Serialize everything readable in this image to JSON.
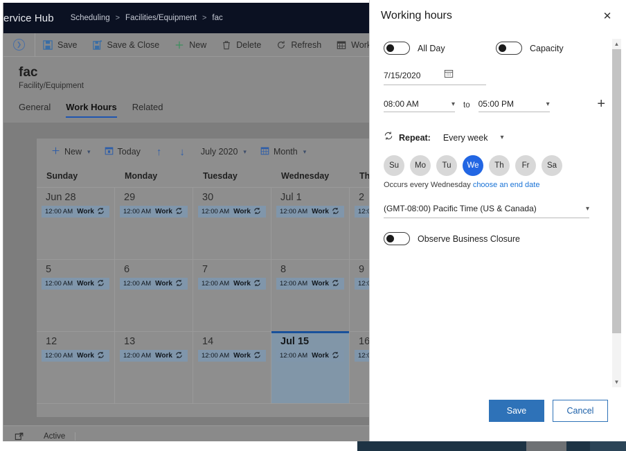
{
  "app": {
    "brand": "ervice Hub",
    "breadcrumb": [
      "Scheduling",
      "Facilities/Equipment",
      "fac"
    ],
    "breadcrumb_separator": ">"
  },
  "commandbar": {
    "expand_icon": "chevron-circle-icon",
    "items": [
      {
        "label": "Save",
        "icon": "save-icon"
      },
      {
        "label": "Save & Close",
        "icon": "save-close-icon"
      },
      {
        "label": "New",
        "icon": "plus-icon"
      },
      {
        "label": "Delete",
        "icon": "trash-icon"
      },
      {
        "label": "Refresh",
        "icon": "refresh-icon"
      },
      {
        "label": "Work H",
        "icon": "calendar-grid-icon"
      }
    ]
  },
  "record": {
    "title": "fac",
    "subtitle": "Facility/Equipment",
    "tabs": [
      {
        "label": "General",
        "active": false
      },
      {
        "label": "Work Hours",
        "active": true
      },
      {
        "label": "Related",
        "active": false
      }
    ]
  },
  "calendar": {
    "toolbar": {
      "new_label": "New",
      "today_label": "Today",
      "up_arrow": "arrow-up-icon",
      "down_arrow": "arrow-down-icon",
      "period_label": "July 2020",
      "view_label": "Month"
    },
    "day_headers": [
      "Sunday",
      "Monday",
      "Tuesday",
      "Wednesday",
      "Thursday"
    ],
    "event_time": "12:00 AM",
    "event_name": "Work",
    "event_icon": "recurrence-icon",
    "weeks": [
      {
        "days": [
          {
            "label": "Jun 28",
            "today": false,
            "event": true
          },
          {
            "label": "29",
            "today": false,
            "event": true
          },
          {
            "label": "30",
            "today": false,
            "event": true
          },
          {
            "label": "Jul 1",
            "today": false,
            "event": true
          },
          {
            "label": "2",
            "today": false,
            "event": true
          }
        ]
      },
      {
        "days": [
          {
            "label": "5",
            "today": false,
            "event": true
          },
          {
            "label": "6",
            "today": false,
            "event": true
          },
          {
            "label": "7",
            "today": false,
            "event": true
          },
          {
            "label": "8",
            "today": false,
            "event": true
          },
          {
            "label": "9",
            "today": false,
            "event": true
          }
        ]
      },
      {
        "days": [
          {
            "label": "12",
            "today": false,
            "event": true
          },
          {
            "label": "13",
            "today": false,
            "event": true
          },
          {
            "label": "14",
            "today": false,
            "event": true
          },
          {
            "label": "Jul 15",
            "today": true,
            "event": true
          },
          {
            "label": "16",
            "today": false,
            "event": true
          }
        ]
      }
    ]
  },
  "statusbar": {
    "icon": "open-record-icon",
    "text": "Active"
  },
  "dialog": {
    "title": "Working hours",
    "close_icon": "close-icon",
    "toggles": {
      "all_day": {
        "label": "All Day",
        "on": false
      },
      "capacity": {
        "label": "Capacity",
        "on": false
      },
      "observe_business_closure": {
        "label": "Observe Business Closure",
        "on": false
      }
    },
    "date": {
      "value": "7/15/2020",
      "icon": "calendar-icon"
    },
    "time": {
      "start": "08:00 AM",
      "to_label": "to",
      "end": "05:00 PM",
      "add_icon": "plus-icon"
    },
    "repeat": {
      "icon": "recurrence-icon",
      "label": "Repeat:",
      "value": "Every week",
      "days": [
        {
          "label": "Su",
          "selected": false
        },
        {
          "label": "Mo",
          "selected": false
        },
        {
          "label": "Tu",
          "selected": false
        },
        {
          "label": "We",
          "selected": true
        },
        {
          "label": "Th",
          "selected": false
        },
        {
          "label": "Fr",
          "selected": false
        },
        {
          "label": "Sa",
          "selected": false
        }
      ],
      "occurs_text": "Occurs every Wednesday",
      "end_date_link": "choose an end date"
    },
    "timezone": {
      "value": "(GMT-08:00) Pacific Time (US & Canada)"
    },
    "buttons": {
      "save": "Save",
      "cancel": "Cancel"
    },
    "accent_color": "#2266e3",
    "primary_button_color": "#2e72b8"
  }
}
